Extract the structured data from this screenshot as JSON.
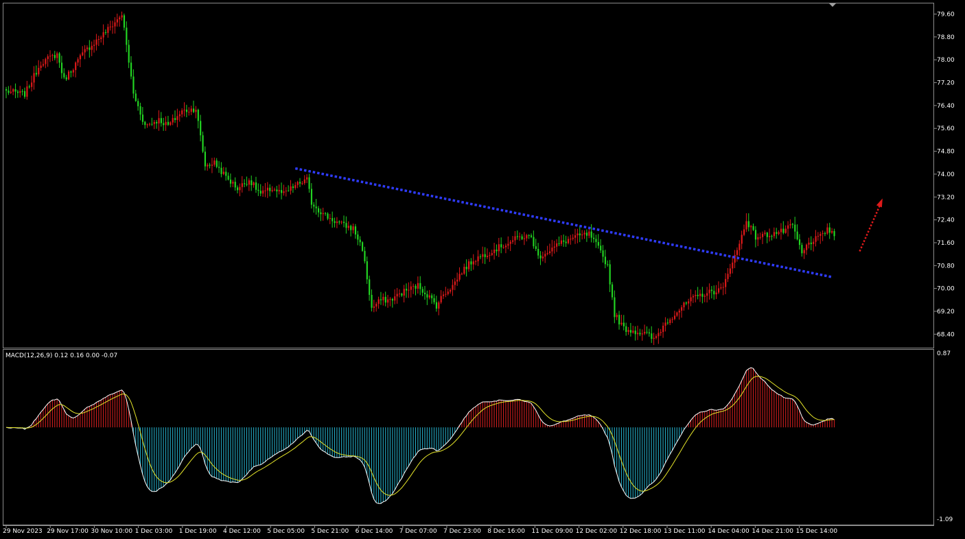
{
  "chart_data": {
    "type": "candlestick",
    "x_labels": [
      "29 Nov 2023",
      "29 Nov 17:00",
      "30 Nov 10:00",
      "1 Dec 03:00",
      "1 Dec 19:00",
      "4 Dec 12:00",
      "5 Dec 05:00",
      "5 Dec 21:00",
      "6 Dec 14:00",
      "7 Dec 07:00",
      "7 Dec 23:00",
      "8 Dec 16:00",
      "11 Dec 09:00",
      "12 Dec 02:00",
      "12 Dec 18:00",
      "13 Dec 11:00",
      "14 Dec 04:00",
      "14 Dec 21:00",
      "15 Dec 14:00"
    ],
    "price_ticks": [
      "79.60",
      "78.80",
      "78.00",
      "77.20",
      "76.40",
      "75.60",
      "74.80",
      "74.00",
      "73.20",
      "72.40",
      "71.60",
      "70.80",
      "70.00",
      "69.20",
      "68.40"
    ],
    "price_range": [
      68.0,
      79.9
    ],
    "price_path": [
      [
        0,
        76.9
      ],
      [
        8,
        76.8
      ],
      [
        15,
        77.9
      ],
      [
        22,
        78.2
      ],
      [
        25,
        77.3
      ],
      [
        34,
        78.3
      ],
      [
        42,
        78.9
      ],
      [
        48,
        79.4
      ],
      [
        50,
        79.6
      ],
      [
        52,
        78.5
      ],
      [
        55,
        76.8
      ],
      [
        60,
        75.7
      ],
      [
        66,
        75.9
      ],
      [
        70,
        75.7
      ],
      [
        76,
        76.2
      ],
      [
        82,
        76.3
      ],
      [
        86,
        74.3
      ],
      [
        90,
        74.4
      ],
      [
        95,
        73.9
      ],
      [
        100,
        73.5
      ],
      [
        105,
        73.8
      ],
      [
        110,
        73.3
      ],
      [
        115,
        73.5
      ],
      [
        120,
        73.3
      ],
      [
        125,
        73.6
      ],
      [
        130,
        73.8
      ],
      [
        132,
        73.0
      ],
      [
        137,
        72.6
      ],
      [
        141,
        72.4
      ],
      [
        146,
        72.2
      ],
      [
        150,
        72.1
      ],
      [
        154,
        71.4
      ],
      [
        158,
        69.3
      ],
      [
        162,
        69.6
      ],
      [
        166,
        69.6
      ],
      [
        172,
        69.9
      ],
      [
        178,
        70.1
      ],
      [
        183,
        69.7
      ],
      [
        186,
        69.4
      ],
      [
        189,
        69.8
      ],
      [
        193,
        70.1
      ],
      [
        197,
        70.6
      ],
      [
        202,
        71.0
      ],
      [
        207,
        71.2
      ],
      [
        212,
        71.4
      ],
      [
        217,
        71.6
      ],
      [
        222,
        71.8
      ],
      [
        227,
        71.8
      ],
      [
        230,
        71.1
      ],
      [
        234,
        71.3
      ],
      [
        240,
        71.6
      ],
      [
        246,
        71.8
      ],
      [
        252,
        71.9
      ],
      [
        256,
        71.4
      ],
      [
        260,
        70.8
      ],
      [
        263,
        69.1
      ],
      [
        267,
        68.6
      ],
      [
        272,
        68.5
      ],
      [
        277,
        68.4
      ],
      [
        280,
        68.2
      ],
      [
        285,
        68.8
      ],
      [
        290,
        69.2
      ],
      [
        296,
        69.6
      ],
      [
        301,
        69.8
      ],
      [
        306,
        69.9
      ],
      [
        310,
        70.0
      ],
      [
        313,
        70.8
      ],
      [
        316,
        71.3
      ],
      [
        320,
        72.4
      ],
      [
        324,
        71.8
      ],
      [
        330,
        71.9
      ],
      [
        336,
        72.0
      ],
      [
        340,
        72.2
      ],
      [
        344,
        71.2
      ],
      [
        347,
        71.6
      ],
      [
        352,
        71.8
      ],
      [
        355,
        72.1
      ],
      [
        358,
        71.8
      ]
    ],
    "candle_count": 359,
    "trendline": {
      "start": [
        125,
        74.2
      ],
      "end": [
        357,
        70.4
      ],
      "color": "#2f3cff",
      "style": "dotted"
    },
    "arrow": {
      "start": [
        369,
        71.3
      ],
      "end": [
        378,
        73.1
      ],
      "color": "#e01a1a",
      "style": "dotted"
    },
    "bull_color": "#e01a1a",
    "bear_color": "#22d422",
    "macd": {
      "label": "MACD(12,26,9) 0.12 0.16 0.00 -0.07",
      "y_ticks": [
        "0.87",
        "-1.09"
      ],
      "range": [
        -1.09,
        0.87
      ],
      "hist_pos_color": "#e02020",
      "hist_neg_color": "#26b8d4",
      "macd_color": "#ffffff",
      "signal_color": "#e6e62a"
    }
  }
}
